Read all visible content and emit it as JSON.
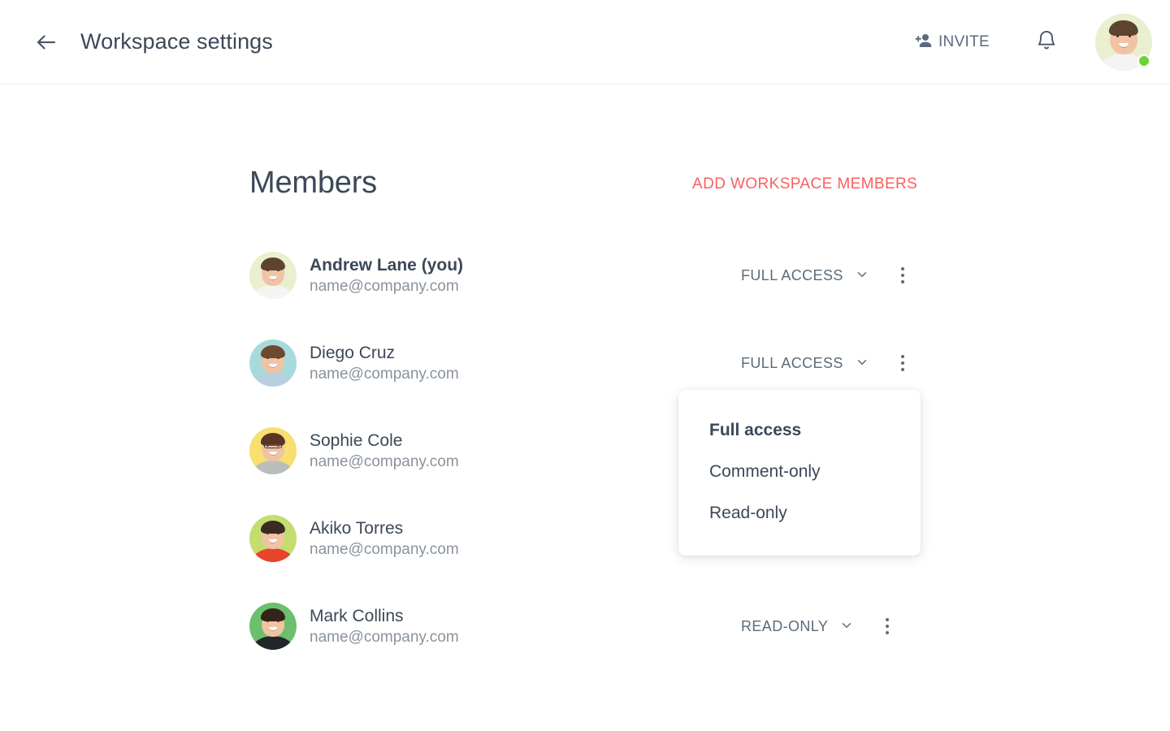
{
  "header": {
    "back_icon": "arrow-left-icon",
    "title": "Workspace settings",
    "invite": {
      "label": "INVITE",
      "icon": "person-add-icon"
    },
    "notifications_icon": "bell-icon",
    "avatar": {
      "name": "avatar-andrew-lane",
      "bg": "#e9efcf",
      "status": "online",
      "status_color": "#68d436"
    }
  },
  "main": {
    "section_title": "Members",
    "add_members_label": "ADD WORKSPACE MEMBERS",
    "accent_color": "#fa5f5f",
    "members": [
      {
        "name": "Andrew Lane (you)",
        "email": "name@company.com",
        "is_you": true,
        "role": "FULL ACCESS",
        "avatar_bg": "#e9efcf",
        "hair": "#5d4430",
        "shirt": "#f4f4f2",
        "glasses": false
      },
      {
        "name": "Diego Cruz",
        "email": "name@company.com",
        "is_you": false,
        "role": "FULL ACCESS",
        "avatar_bg": "#a8dadb",
        "hair": "#6b4a2f",
        "shirt": "#b9cfe0",
        "glasses": false
      },
      {
        "name": "Sophie Cole",
        "email": "name@company.com",
        "is_you": false,
        "role": "",
        "avatar_bg": "#f7df70",
        "hair": "#5a3524",
        "shirt": "#b9bdbe",
        "glasses": true
      },
      {
        "name": "Akiko Torres",
        "email": "name@company.com",
        "is_you": false,
        "role": "",
        "avatar_bg": "#c3de6e",
        "hair": "#3b2a22",
        "shirt": "#e8442c",
        "glasses": false
      },
      {
        "name": "Mark Collins",
        "email": "name@company.com",
        "is_you": false,
        "role": "READ-ONLY",
        "avatar_bg": "#6cbf6c",
        "hair": "#332318",
        "shirt": "#22262b",
        "glasses": false
      }
    ],
    "role_menu": {
      "open_for_member_index": 1,
      "items": [
        {
          "label": "Full access",
          "selected": true
        },
        {
          "label": "Comment-only",
          "selected": false
        },
        {
          "label": "Read-only",
          "selected": false
        }
      ]
    },
    "chevron_icon": "chevron-down-icon",
    "kebab_icon": "more-vertical-icon"
  }
}
